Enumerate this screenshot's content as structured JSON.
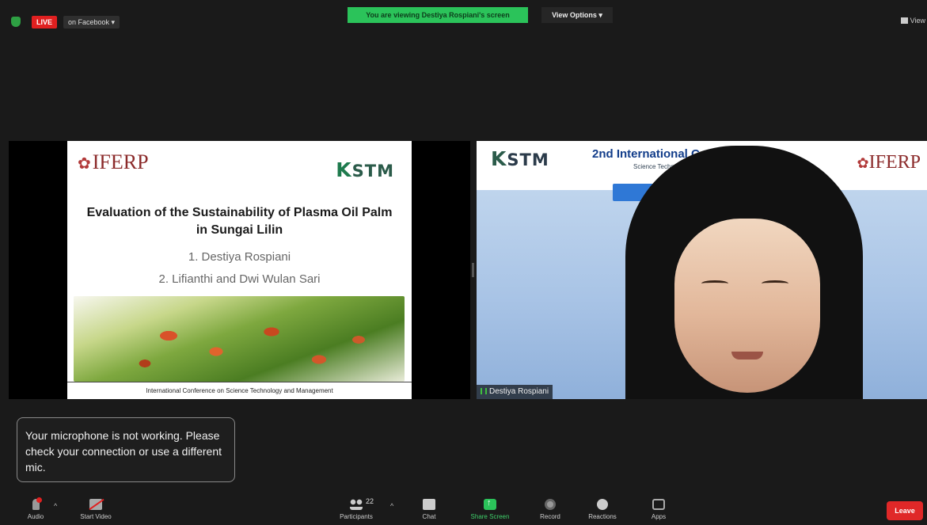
{
  "top_bar": {
    "live_badge": "LIVE",
    "live_destination": "on Facebook ▾",
    "viewing_banner": "You are viewing Destiya Rospiani's screen",
    "view_options": "View Options ▾",
    "view_label": "View"
  },
  "shared_slide": {
    "logo_left": "IFERP",
    "logo_right": "STM",
    "title": "Evaluation of the Sustainability of Plasma Oil Palm in Sungai Lilin",
    "author_1": "1. Destiya Rospiani",
    "author_2": "2. Lifianthi and Dwi Wulan Sari",
    "footer": "International Conference on Science Technology and Management"
  },
  "speaker_tile": {
    "bg_logo_left": "STM",
    "bg_conference_title": "2nd International C",
    "bg_conference_subtitle": "Science Techn",
    "bg_logo_right": "IFERP",
    "participant_name": "Destiya Rospiani"
  },
  "mic_warning": "Your microphone is not working. Please check your connection or use a different mic.",
  "toolbar": {
    "audio": "Audio",
    "start_video": "Start Video",
    "participants": "Participants",
    "participant_count": "22",
    "chat": "Chat",
    "share_screen": "Share Screen",
    "record": "Record",
    "reactions": "Reactions",
    "apps": "Apps",
    "leave": "Leave"
  },
  "colors": {
    "live_red": "#e02020",
    "share_green": "#2bc35a",
    "leave_red": "#e02828"
  }
}
